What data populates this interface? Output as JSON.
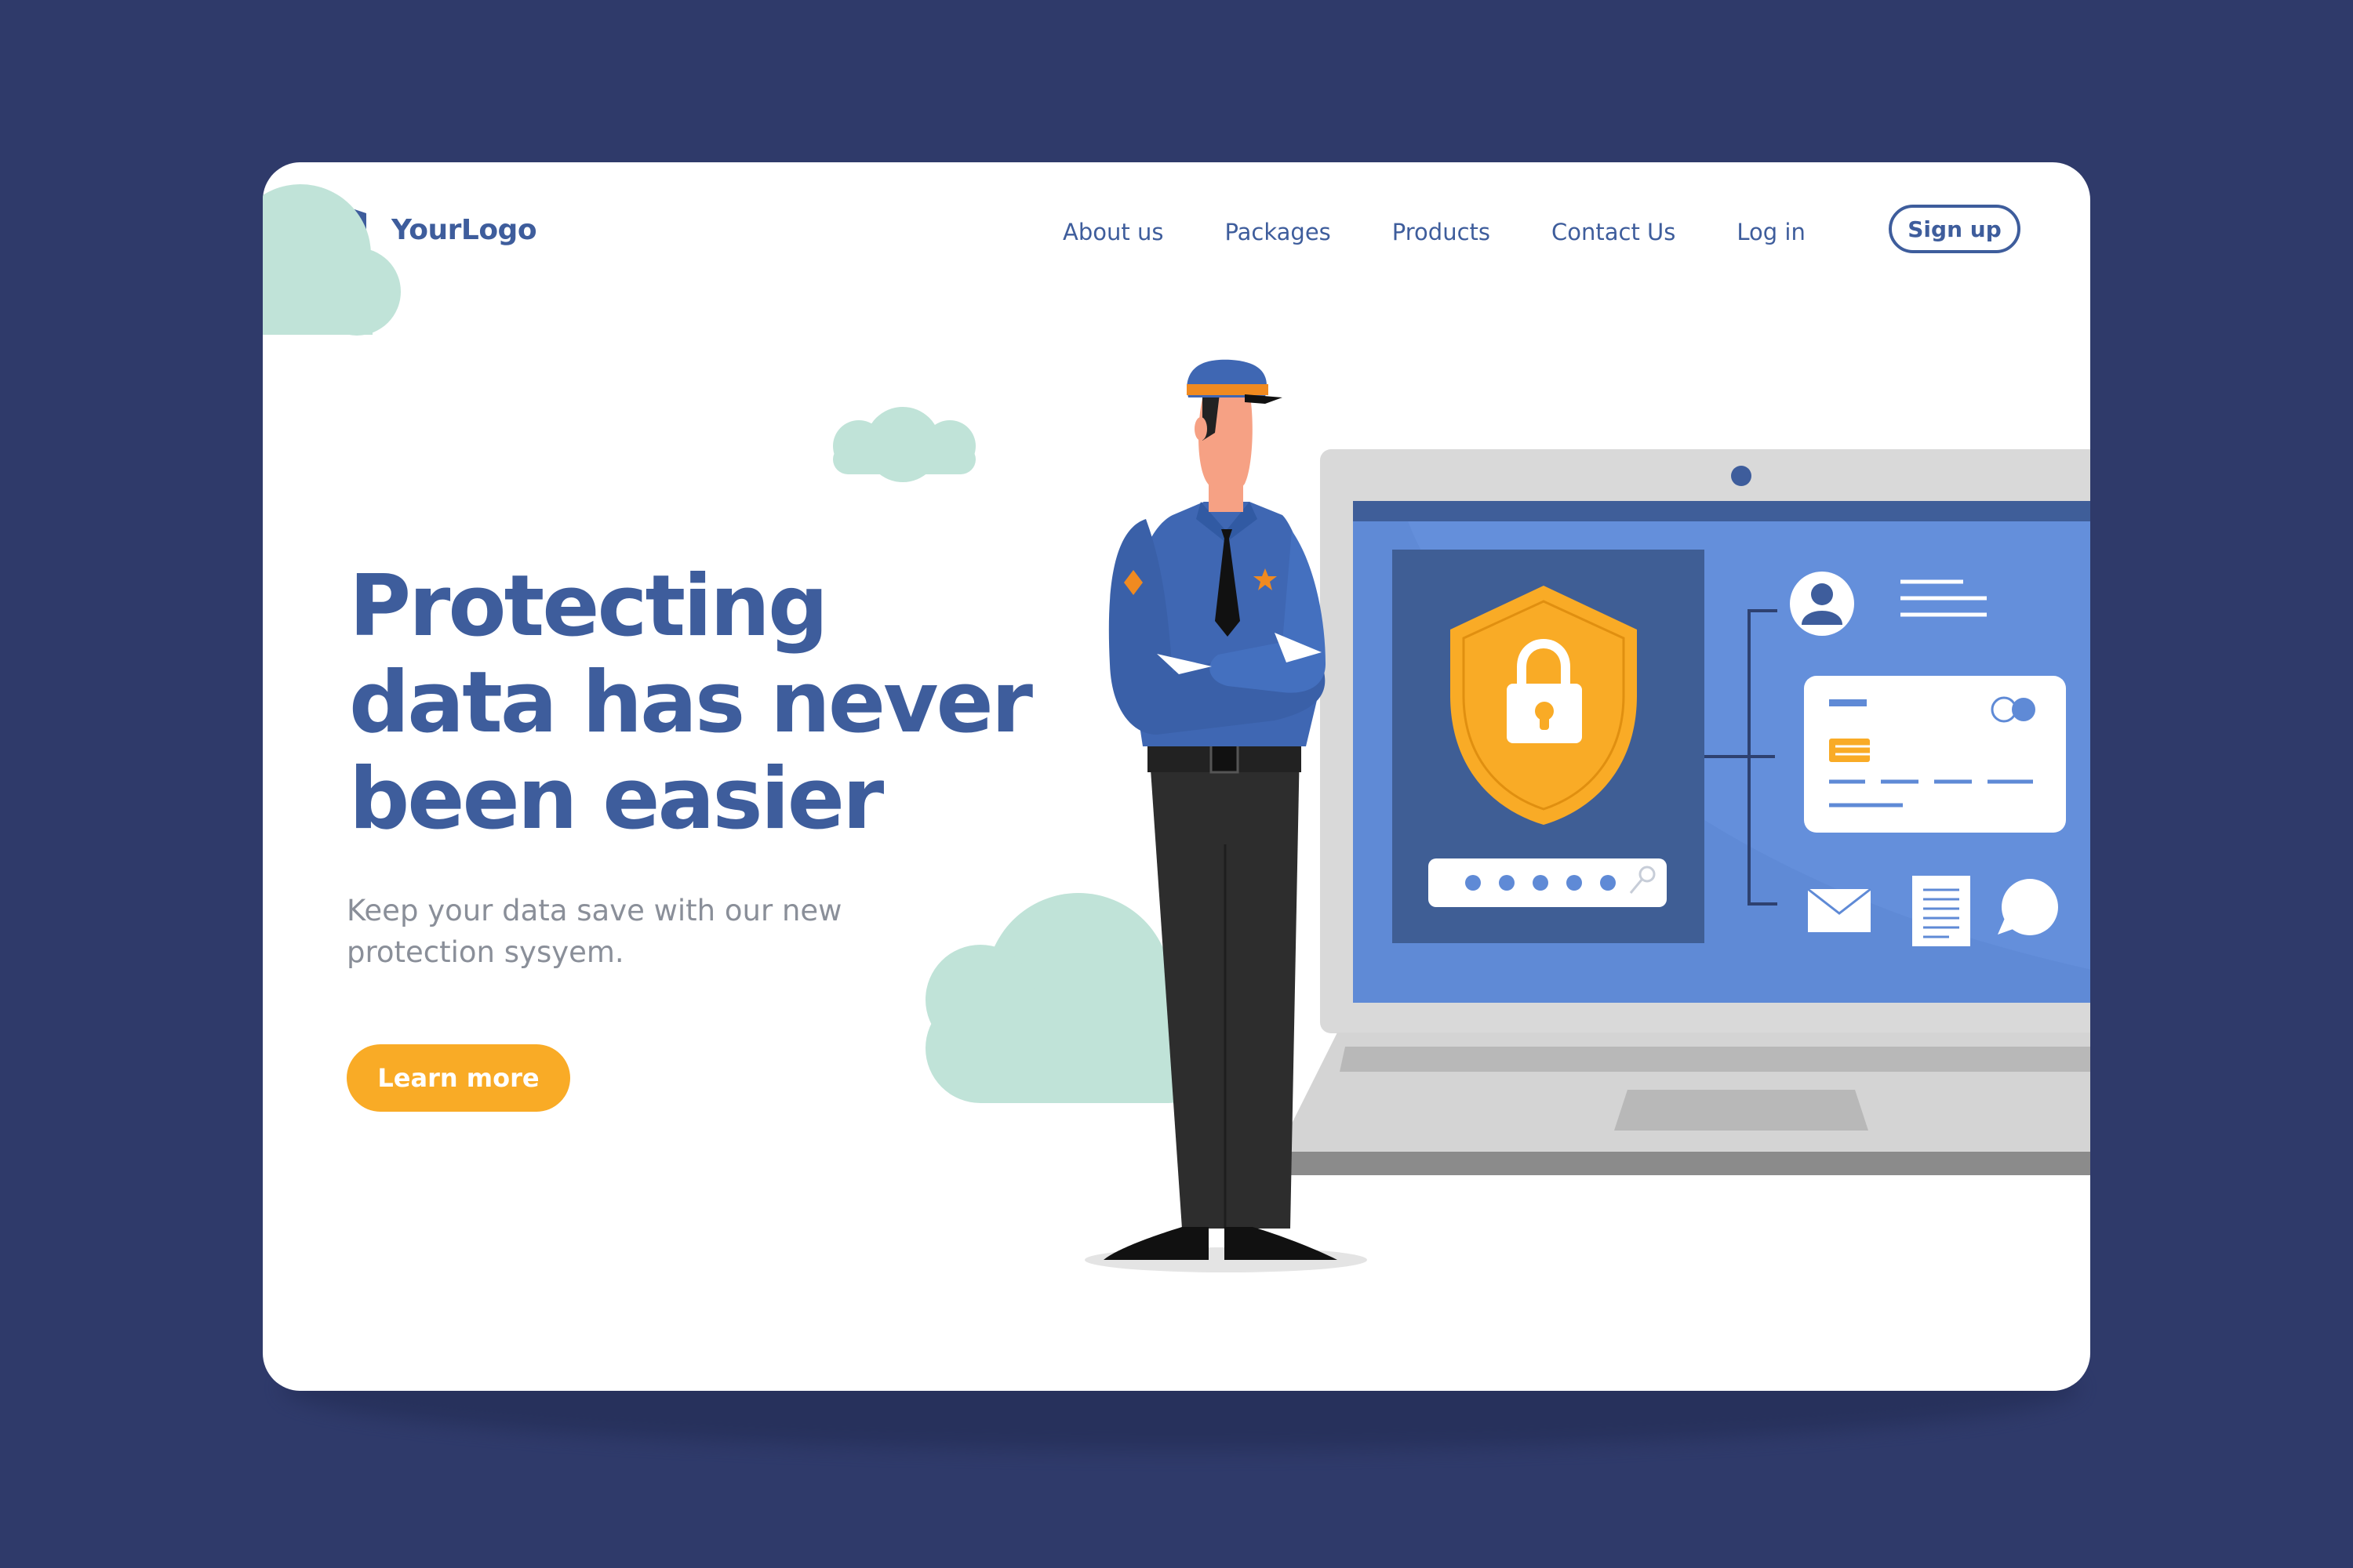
{
  "logo": {
    "text": "YourLogo",
    "icon": "shield-check-icon"
  },
  "nav": {
    "items": [
      {
        "label": "About us"
      },
      {
        "label": "Packages"
      },
      {
        "label": "Products"
      },
      {
        "label": "Contact Us"
      },
      {
        "label": "Log in"
      }
    ],
    "signup_label": "Sign up"
  },
  "hero": {
    "title_lines": [
      "Protecting",
      "data has never",
      "been easier"
    ],
    "subtitle_lines": [
      "Keep your data save with our new",
      "protection sysyem."
    ],
    "cta_label": "Learn more"
  },
  "illustration": {
    "subject": "security-guard",
    "device": "laptop",
    "icons": [
      "shield-lock-icon",
      "password-field-icon",
      "key-icon",
      "user-avatar-icon",
      "credit-card-icon",
      "envelope-icon",
      "document-icon",
      "chat-bubble-icon"
    ]
  },
  "colors": {
    "background": "#2f3a6a",
    "primary": "#3e5d9c",
    "accent": "#f9ab26",
    "cloud": "#c0e3d8",
    "screen": "#5f8ad6"
  }
}
